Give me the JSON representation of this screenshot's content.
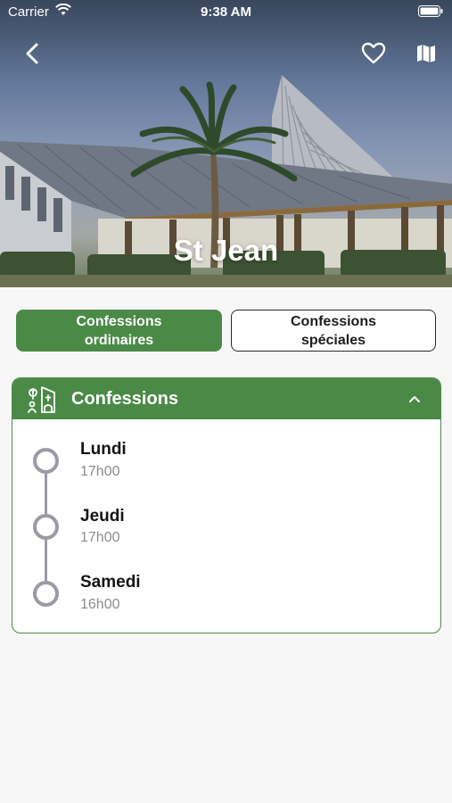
{
  "status_bar": {
    "carrier": "Carrier",
    "time": "9:38 AM"
  },
  "header": {
    "title": "St Jean",
    "back_icon": "chevron-left-icon",
    "favorite_icon": "heart-outline-icon",
    "map_icon": "map-icon"
  },
  "tabs": [
    {
      "label": "Confessions ordinaires",
      "line1": "Confessions",
      "line2": "ordinaires",
      "active": true
    },
    {
      "label": "Confessions spéciales",
      "line1": "Confessions",
      "line2": "spéciales",
      "active": false
    }
  ],
  "card": {
    "title": "Confessions",
    "icon": "church-confession-icon",
    "expanded": true,
    "schedule": [
      {
        "day": "Lundi",
        "time": "17h00"
      },
      {
        "day": "Jeudi",
        "time": "17h00"
      },
      {
        "day": "Samedi",
        "time": "16h00"
      }
    ]
  },
  "colors": {
    "accent_green": "#4b8a46",
    "timeline_gray": "#9a9ba4"
  }
}
